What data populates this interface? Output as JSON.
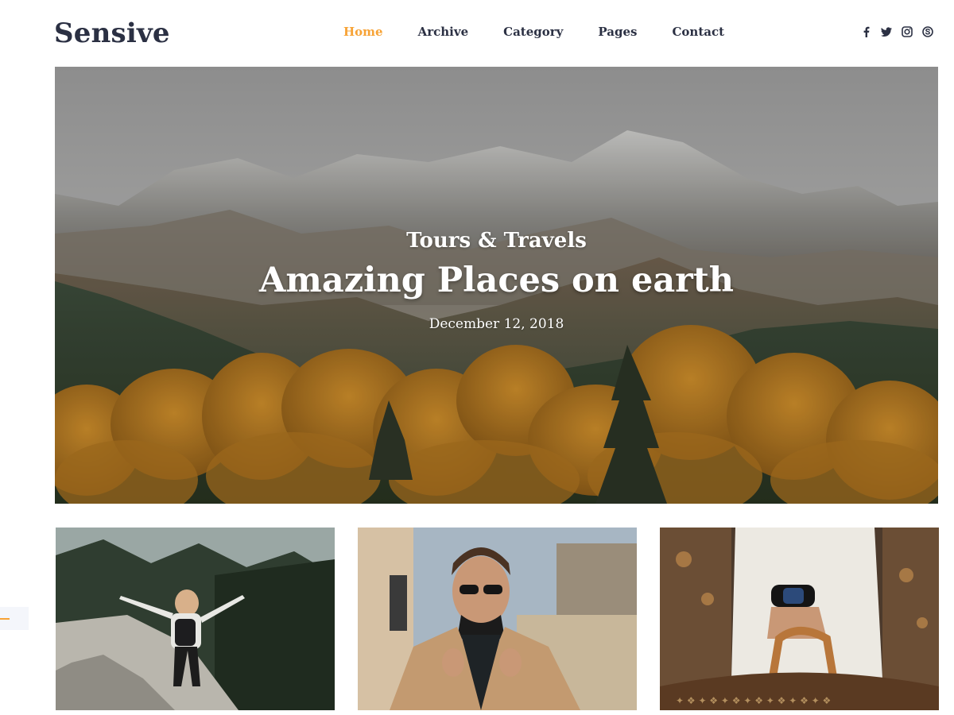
{
  "header": {
    "logo": "Sensive",
    "nav": [
      {
        "label": "Home",
        "active": true
      },
      {
        "label": "Archive",
        "active": false
      },
      {
        "label": "Category",
        "active": false
      },
      {
        "label": "Pages",
        "active": false
      },
      {
        "label": "Contact",
        "active": false
      }
    ],
    "social_icons": [
      "facebook-icon",
      "twitter-icon",
      "instagram-icon",
      "skype-icon"
    ]
  },
  "hero": {
    "category": "Tours & Travels",
    "title": "Amazing Places on earth",
    "date": "December 12, 2018"
  },
  "cards": [
    {
      "image": "hiker-on-mountain-trail"
    },
    {
      "image": "man-in-sunglasses-street"
    },
    {
      "image": "watch-and-handbag"
    }
  ],
  "colors": {
    "accent": "#f7a336",
    "heading": "#2b3043"
  }
}
